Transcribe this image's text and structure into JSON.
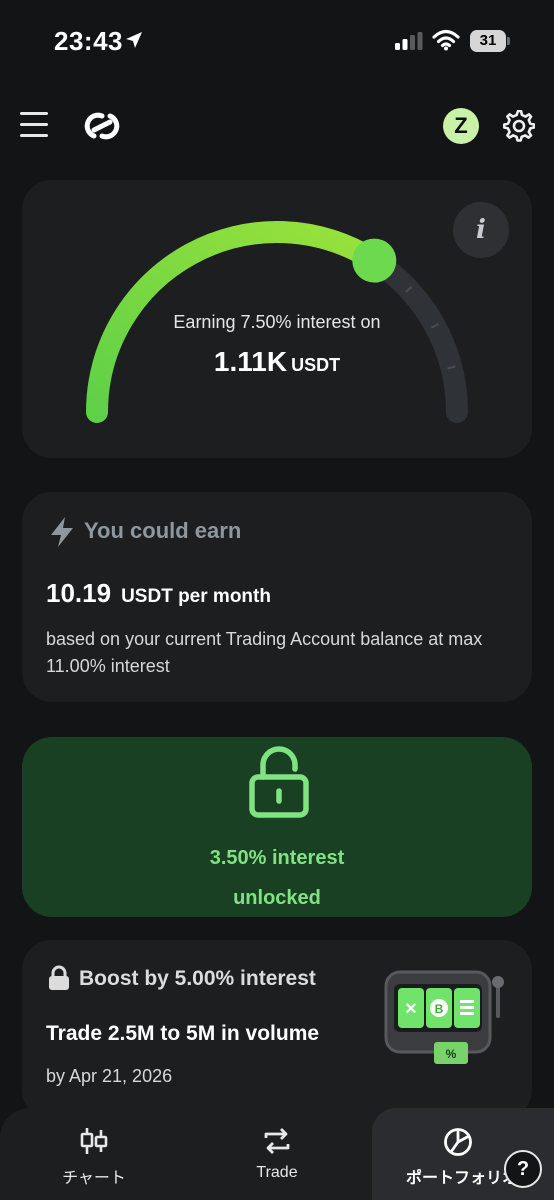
{
  "status_bar": {
    "time": "23:43",
    "battery": "31",
    "icons": [
      "location-arrow-icon",
      "signal-icon",
      "wifi-icon",
      "battery-icon"
    ]
  },
  "top_nav": {
    "icons": [
      "menu-icon",
      "logo-icon",
      "gear-icon"
    ],
    "avatar_initial": "Z",
    "avatar_color": "#c9f2a8"
  },
  "interest_gauge": {
    "label": "Earning 7.50% interest on",
    "amount": "1.11K",
    "unit": "USDT",
    "current_rate": 7.5,
    "max_rate": 11.0,
    "accent": "#6cd94e",
    "info_icon": "info-icon"
  },
  "earn_card": {
    "title": "You could earn",
    "amount": "10.19",
    "unit": "USDT per month",
    "description": "based on your current Trading Account balance at max 11.00% interest",
    "icon": "lightning-bolt-icon"
  },
  "unlocked_card": {
    "line1": "3.50% interest",
    "line2": "unlocked",
    "icon": "lock-open-icon",
    "bg": "#1a4023",
    "text_color": "#7fe381"
  },
  "boost_card": {
    "title": "Boost by 5.00% interest",
    "task": "Trade 2.5M to 5M in volume",
    "deadline": "by Apr 21, 2026",
    "icons": [
      "lock-icon",
      "slot-machine-icon"
    ]
  },
  "bottom_nav": {
    "items": [
      {
        "label": "チャート",
        "icon": "candlestick-chart-icon"
      },
      {
        "label": "Trade",
        "icon": "swap-arrows-icon"
      },
      {
        "label": "ポートフォリオ",
        "icon": "pie-chart-icon",
        "active": true
      }
    ],
    "help_label": "?"
  }
}
